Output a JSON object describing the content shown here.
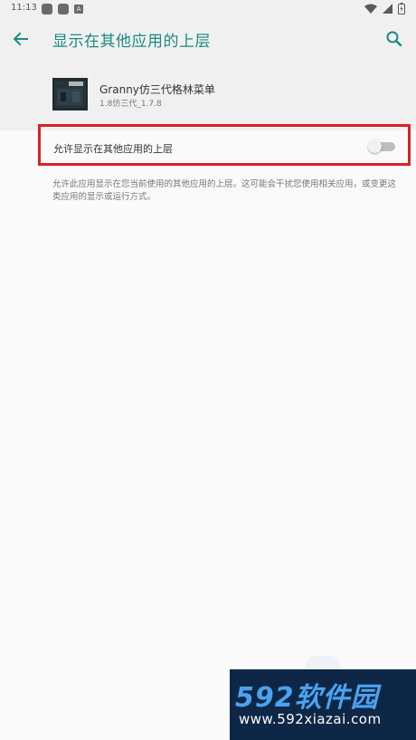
{
  "status_bar": {
    "time": "11:13",
    "notification_icons": [
      "app-icon",
      "app-icon",
      "a-icon"
    ],
    "system_icons": [
      "wifi-icon",
      "signal-icon",
      "battery-icon"
    ]
  },
  "app_bar": {
    "title": "显示在其他应用的上层",
    "back_icon": "arrow-left-icon",
    "search_icon": "search-icon"
  },
  "app_info": {
    "name": "Granny仿三代格林菜单",
    "version": "1.8仿三代_1.7.8"
  },
  "toggle": {
    "label": "允许显示在其他应用的上层",
    "checked": false
  },
  "description": "允许此应用显示在您当前使用的其他应用的上层。这可能会干扰您使用相关应用，或变更这类应用的显示或运行方式。",
  "watermark": {
    "logo": "592软件园",
    "url": "www.592xiazai.com"
  },
  "colors": {
    "accent": "#1b8a80",
    "highlight_border": "#d6222a"
  }
}
